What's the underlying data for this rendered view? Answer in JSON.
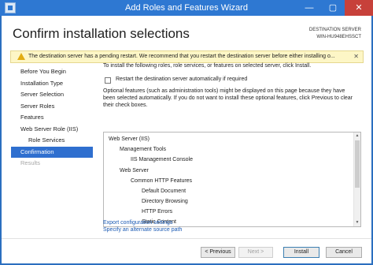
{
  "window": {
    "title": "Add Roles and Features Wizard",
    "controls": {
      "minimize": "—",
      "maximize": "▢",
      "close": "✕"
    }
  },
  "header": {
    "title": "Confirm installation selections",
    "destination_label": "DESTINATION SERVER",
    "destination_server": "WIN-HU948EHSSCT"
  },
  "warning": {
    "text": "The destination server has a pending restart. We recommend that you restart the destination server before either installing o...",
    "close": "✕"
  },
  "nav": {
    "items": [
      {
        "label": "Before You Begin"
      },
      {
        "label": "Installation Type"
      },
      {
        "label": "Server Selection"
      },
      {
        "label": "Server Roles"
      },
      {
        "label": "Features"
      },
      {
        "label": "Web Server Role (IIS)"
      },
      {
        "label": "Role Services"
      },
      {
        "label": "Confirmation"
      },
      {
        "label": "Results"
      }
    ]
  },
  "content": {
    "lead": "To install the following roles, role services, or features on selected server, click Install.",
    "restart_checkbox_label": "Restart the destination server automatically if required",
    "restart_checked": false,
    "optional_note": "Optional features (such as administration tools) might be displayed on this page because they have been selected automatically. If you do not want to install these optional features, click Previous to clear their check boxes."
  },
  "selections": [
    {
      "label": "Web Server (IIS)"
    },
    {
      "label": "Management Tools"
    },
    {
      "label": "IIS Management Console"
    },
    {
      "label": "Web Server"
    },
    {
      "label": "Common HTTP Features"
    },
    {
      "label": "Default Document"
    },
    {
      "label": "Directory Browsing"
    },
    {
      "label": "HTTP Errors"
    },
    {
      "label": "Static Content"
    }
  ],
  "scrollbar": {
    "up": "▲",
    "down": "▼"
  },
  "links": {
    "export": "Export configuration settings",
    "source": "Specify an alternate source path"
  },
  "buttons": {
    "previous": "< Previous",
    "next": "Next >",
    "install": "Install",
    "cancel": "Cancel"
  },
  "colors": {
    "title_bar": "#2e78d2",
    "nav_active": "#2f6fcf",
    "warning_bg": "#fdf6c6",
    "link": "#1a59b3"
  }
}
